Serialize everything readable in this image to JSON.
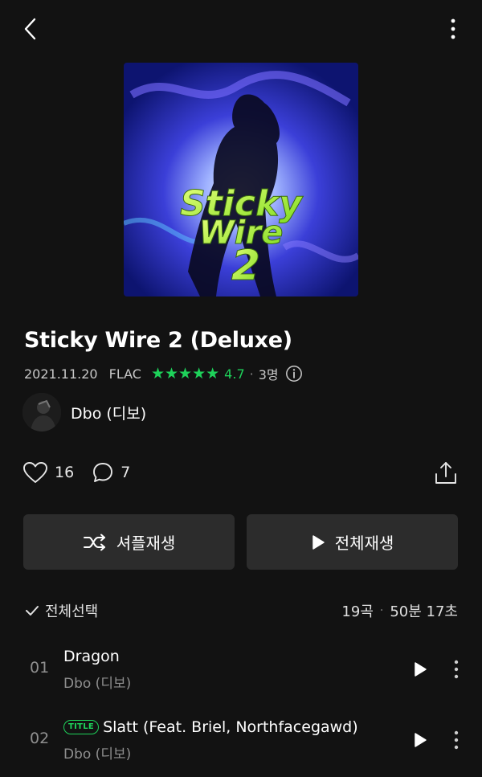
{
  "album": {
    "title": "Sticky Wire 2 (Deluxe)",
    "release_date": "2021.11.20",
    "format": "FLAC",
    "stars": 5,
    "rating": "4.7",
    "rating_count": "3명",
    "cover_text_line1": "Sticky",
    "cover_text_line2": "Wire",
    "cover_text_line3": "2"
  },
  "artist": {
    "name": "Dbo (디보)"
  },
  "social": {
    "likes": "16",
    "comments": "7"
  },
  "actions": {
    "shuffle_label": "셔플재생",
    "play_all_label": "전체재생"
  },
  "tracklist": {
    "select_all_label": "전체선택",
    "count": "19곡",
    "duration": "50분 17초"
  },
  "tracks": [
    {
      "number": "01",
      "title": "Dragon",
      "artist": "Dbo (디보)",
      "badge": ""
    },
    {
      "number": "02",
      "title": "Slatt (Feat. Briel, Northfacegawd)",
      "artist": "Dbo (디보)",
      "badge": "TITLE"
    }
  ],
  "colors": {
    "background": "#121212",
    "accent_green": "#1ed25a",
    "button_bg": "#2c2c2c"
  },
  "icons": [
    "back-arrow-icon",
    "more-vertical-icon",
    "star-icon",
    "info-icon",
    "heart-icon",
    "comment-icon",
    "share-icon",
    "shuffle-icon",
    "play-icon",
    "check-icon"
  ]
}
